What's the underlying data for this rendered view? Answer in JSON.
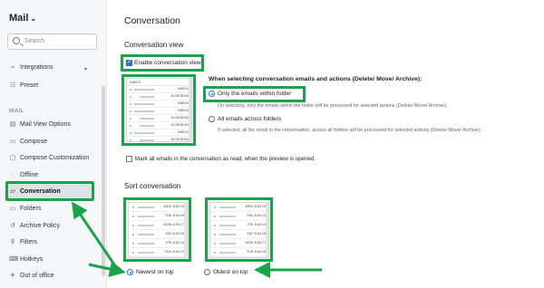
{
  "sidebar": {
    "app_title": "Mail",
    "search_placeholder": "Search",
    "section_label": "MAIL",
    "items": [
      {
        "label": "Integrations",
        "icon": "plug-icon"
      },
      {
        "label": "Preset",
        "icon": "preset-icon"
      },
      {
        "label": "Mail View Options",
        "icon": "mail-view-icon"
      },
      {
        "label": "Compose",
        "icon": "compose-icon"
      },
      {
        "label": "Compose Customization",
        "icon": "compose-custom-icon"
      },
      {
        "label": "Offline",
        "icon": "offline-icon"
      },
      {
        "label": "Conversation",
        "icon": "conversation-icon",
        "active": true
      },
      {
        "label": "Folders",
        "icon": "folder-icon"
      },
      {
        "label": "Archive Policy",
        "icon": "archive-icon"
      },
      {
        "label": "Filters",
        "icon": "filter-icon"
      },
      {
        "label": "Hotkeys",
        "icon": "hotkey-icon"
      },
      {
        "label": "Out of office",
        "icon": "out-of-office-icon"
      }
    ]
  },
  "main": {
    "page_title": "Conversation",
    "conversation_view": {
      "title": "Conversation view",
      "enable_label": "Enable conversation view",
      "enable_checked": true
    },
    "selection": {
      "title": "When selecting conversation emails and actions (Delete/ Move/ Archive):",
      "option1_label": "Only the emails within folder",
      "option1_desc": "On selecting, only the emails within the folder will be processed for selected actions (Delete/ Move/ Archive).",
      "option2_label": "All emails across folders",
      "option2_desc": "If selected, all the email in the conversation, across all folders will be processed for selected actions (Delete/ Move/ Archive).",
      "selected": "option1"
    },
    "mark_read_label": "Mark all emails in the conversation as read, when the preview is opened.",
    "mark_read_checked": false,
    "preview_thumb": {
      "header": "INBOX",
      "rows": [
        {
          "label": "INBOX",
          "indent": false
        },
        {
          "label": "UI DESIGN",
          "indent": true
        },
        {
          "label": "INBOX",
          "indent": false
        },
        {
          "label": "INBOX",
          "indent": false
        },
        {
          "label": "UI DESIGN",
          "indent": true
        },
        {
          "label": "UI DESIGN",
          "indent": true
        },
        {
          "label": "INBOX",
          "indent": false
        },
        {
          "label": "UI DESIGN",
          "indent": true
        },
        {
          "label": "INBOX",
          "indent": false
        },
        {
          "label": "INBOX",
          "indent": false
        }
      ]
    },
    "sort": {
      "title": "Sort conversation",
      "newest_label": "Newest on top",
      "oldest_label": "Oldest on top",
      "selected": "newest",
      "newest_rows": [
        "WED JUN 19",
        "TUE JUN 18",
        "MON JUN 17",
        "SAT JUN 15",
        "FRI JUN 14",
        "THU JUN 13"
      ],
      "oldest_rows": [
        "WED JUN 19",
        "THU JUN 13",
        "FRI JUN 14",
        "SAT JUN 15",
        "MON JUN 17",
        "TUE JUN 18"
      ]
    }
  },
  "colors": {
    "highlight": "#1aa34a",
    "accent": "#2a6fd6"
  }
}
